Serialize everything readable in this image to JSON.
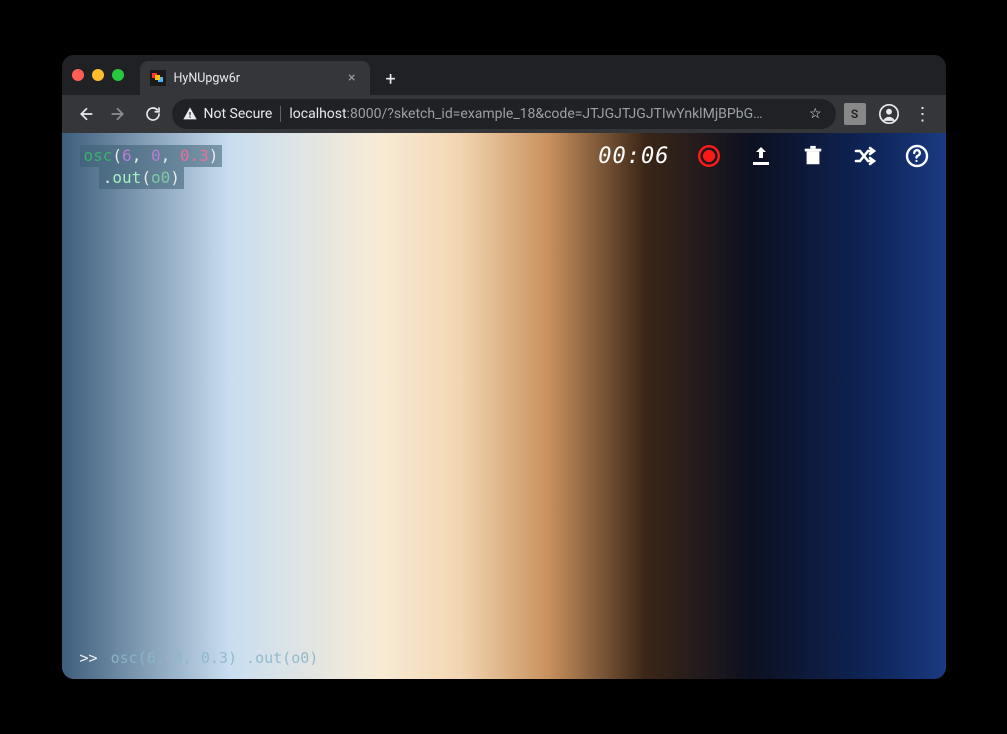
{
  "browser": {
    "tab_title": "HyNUpgw6r",
    "tab_close_glyph": "×",
    "new_tab_glyph": "+",
    "not_secure_label": "Not Secure",
    "url_host": "localhost",
    "url_port_path": ":8000/?sketch_id=example_18&code=JTJGJTJGJTIwYnklMjBPbG…",
    "star_glyph": "☆",
    "s_badge": "S",
    "menu_glyph": "⋮"
  },
  "editor": {
    "line1": {
      "fn": "osc",
      "open": "(",
      "a1": "6",
      "c1": ", ",
      "a2": "0",
      "c2": ", ",
      "a3": "0.3",
      "close": ")"
    },
    "line2": {
      "dot": ".",
      "method": "out",
      "open": "(",
      "arg": "o0",
      "close": ")"
    }
  },
  "hud": {
    "timer": "00:06"
  },
  "console": {
    "prompt": ">>",
    "text": "osc(6, 0, 0.3) .out(o0)"
  }
}
